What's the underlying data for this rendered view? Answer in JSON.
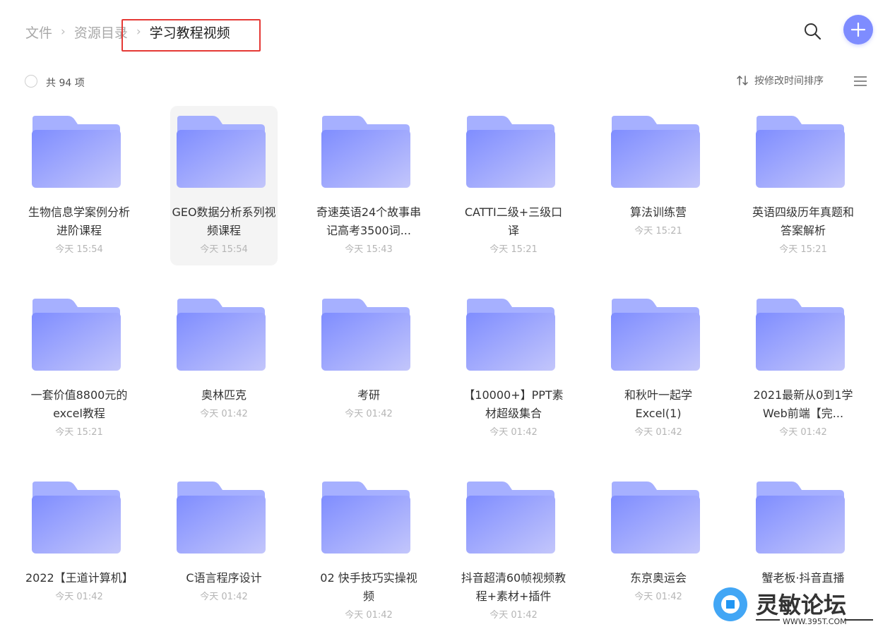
{
  "breadcrumb": [
    {
      "label": "文件"
    },
    {
      "label": "资源目录"
    },
    {
      "label": "学习教程视频"
    }
  ],
  "header": {
    "search_icon": "search-icon",
    "add_icon": "plus-icon"
  },
  "toolbar": {
    "count_text": "共 94 项",
    "sort_label": "按修改时间排序"
  },
  "colors": {
    "accent": "#7e8cff",
    "folder_top": "#a6b0ff",
    "folder_front": "#8d9aff",
    "highlight": "#e53935"
  },
  "items": [
    {
      "name": "生物信息学案例分析进阶课程",
      "date": "今天 15:54"
    },
    {
      "name": "GEO数据分析系列视频课程",
      "date": "今天 15:54",
      "selected": true
    },
    {
      "name": "奇速英语24个故事串记高考3500词...",
      "date": "今天 15:43"
    },
    {
      "name": "CATTI二级+三级口译",
      "date": "今天 15:21"
    },
    {
      "name": "算法训练营",
      "date": "今天 15:21"
    },
    {
      "name": "英语四级历年真题和答案解析",
      "date": "今天 15:21"
    },
    {
      "name": "一套价值8800元的excel教程",
      "date": "今天 15:21"
    },
    {
      "name": "奥林匹克",
      "date": "今天 01:42"
    },
    {
      "name": "考研",
      "date": "今天 01:42"
    },
    {
      "name": "【10000+】PPT素材超级集合",
      "date": "今天 01:42"
    },
    {
      "name": "和秋叶一起学Excel(1)",
      "date": "今天 01:42"
    },
    {
      "name": "2021最新从0到1学Web前端【完...",
      "date": "今天 01:42"
    },
    {
      "name": "2022【王道计算机】",
      "date": "今天 01:42"
    },
    {
      "name": "C语言程序设计",
      "date": "今天 01:42"
    },
    {
      "name": "02 快手技巧实操视频",
      "date": "今天 01:42"
    },
    {
      "name": "抖音超清60帧视频教程+素材+插件",
      "date": "今天 01:42"
    },
    {
      "name": "东京奥运会",
      "date": "今天 01:42"
    },
    {
      "name": "蟹老板·抖音直播",
      "date": ""
    }
  ],
  "watermark": {
    "brand": "灵敏论坛",
    "url": "WWW.395T.COM"
  }
}
